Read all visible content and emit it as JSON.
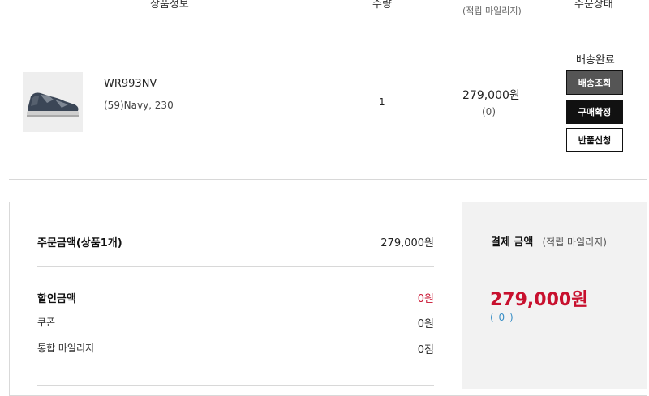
{
  "table_header": {
    "product_info": "상품정보",
    "quantity": "수량",
    "mileage_note": "(적립 마일리지)",
    "order_status": "주문상태"
  },
  "order_item": {
    "image_icon": "sneaker-product-image",
    "name": "WR993NV",
    "option": "(59)Navy, 230",
    "quantity": "1",
    "price": "279,000원",
    "mileage": "(0)",
    "status": "배송완료",
    "buttons": {
      "track": "배송조회",
      "confirm": "구매확정",
      "return": "반품신청"
    }
  },
  "summary": {
    "order_amount_label": "주문금액(상품1개)",
    "order_amount_value": "279,000원",
    "discount_label": "할인금액",
    "discount_value": "0원",
    "coupon_label": "쿠폰",
    "coupon_value": "0원",
    "mileage_label": "통합 마일리지",
    "mileage_value": "0점",
    "payment_title": "결제 금액",
    "payment_sub": "(적립 마일리지)",
    "payment_amount": "279,000원",
    "payment_mileage": "( 0 )"
  },
  "colors": {
    "accent_red": "#c8102e",
    "mileage_blue": "#3a8fc6"
  }
}
